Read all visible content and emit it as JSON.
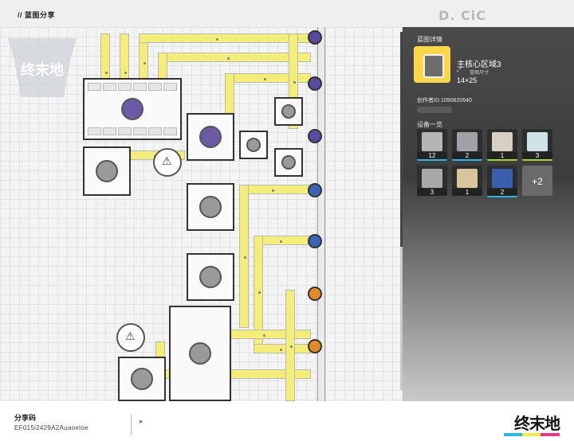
{
  "header": {
    "title": "// 蓝图分享",
    "deco": "D. CiC"
  },
  "panel": {
    "section_title": "蓝图详情",
    "blueprint_name": "主核心区域3",
    "size_label": "蓝图尺寸",
    "size_value": "14×25",
    "creator": "创作者ID.1090620640",
    "devices_title": "设备一览",
    "devices": [
      {
        "icon": "refinery-icon",
        "count": "12"
      },
      {
        "icon": "crusher-icon",
        "count": "2"
      },
      {
        "icon": "mixer-icon",
        "count": "1"
      },
      {
        "icon": "assembler-icon",
        "count": "3"
      },
      {
        "icon": "storage-icon",
        "count": "3"
      },
      {
        "icon": "silo-icon",
        "count": "1"
      },
      {
        "icon": "pylon-icon",
        "count": "2"
      }
    ],
    "more_label": "+2"
  },
  "footer": {
    "share_label": "分享码",
    "share_code": "EF015i2429A2Auaoeloe",
    "brand": "终末地"
  },
  "colors": {
    "accent": "#ffd64a",
    "belt": "#f3ee7a",
    "panel_bg": "#3f3f3f"
  }
}
